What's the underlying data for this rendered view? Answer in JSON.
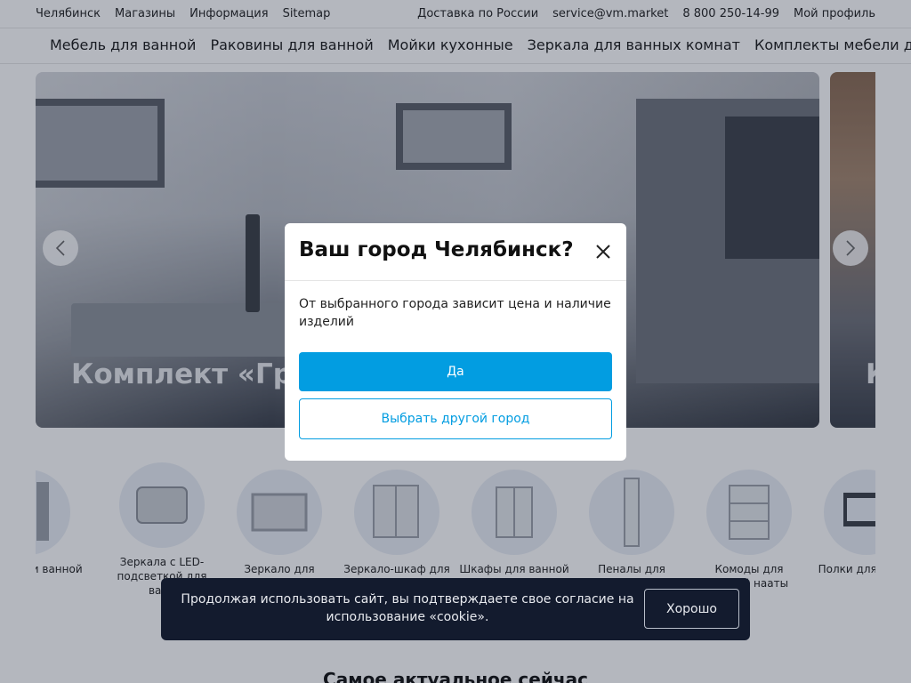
{
  "topbar": {
    "left": [
      "Челябинск",
      "Магазины",
      "Информация",
      "Sitemap"
    ],
    "right": [
      "Доставка по России",
      "service@vm.market",
      "8 800 250-14-99",
      "Мой профиль"
    ]
  },
  "catnav": [
    "Мебель для ванной",
    "Раковины для ванной",
    "Мойки кухонные",
    "Зеркала для ванных комнат",
    "Комплекты мебели д"
  ],
  "slider": {
    "caption": "Комплект «Гр",
    "caption_next": "К"
  },
  "categories": [
    {
      "label": "кты мебели ванной",
      "icon": "vanity-set-icon"
    },
    {
      "label": "Зеркала с LED-подсветкой для ванн",
      "icon": "led-mirror-icon"
    },
    {
      "label": "Зеркало для",
      "icon": "mirror-icon"
    },
    {
      "label": "Зеркало-шкаф для",
      "icon": "mirror-cabinet-icon"
    },
    {
      "label": "Шкафы для ванной",
      "icon": "wardrobe-icon"
    },
    {
      "label": "Пеналы для ванной",
      "icon": "tall-cabinet-icon"
    },
    {
      "label": "Комоды для ванной нааты",
      "icon": "dresser-icon"
    },
    {
      "label": "Полки для комна",
      "icon": "shelf-icon"
    }
  ],
  "modal": {
    "title": "Ваш город Челябинск?",
    "text": "От выбранного города зависит цена и наличие изделий",
    "yes_label": "Да",
    "other_label": "Выбрать другой город"
  },
  "cookie": {
    "message": "Продолжая использовать сайт, вы подтверждаете свое согласие на использование «cookie».",
    "ok_label": "Хорошо"
  },
  "section_title": "Самое актуальное сейчас",
  "colors": {
    "accent": "#029de1",
    "overlay": "#161f34",
    "cookie_bg": "#131b2e"
  }
}
